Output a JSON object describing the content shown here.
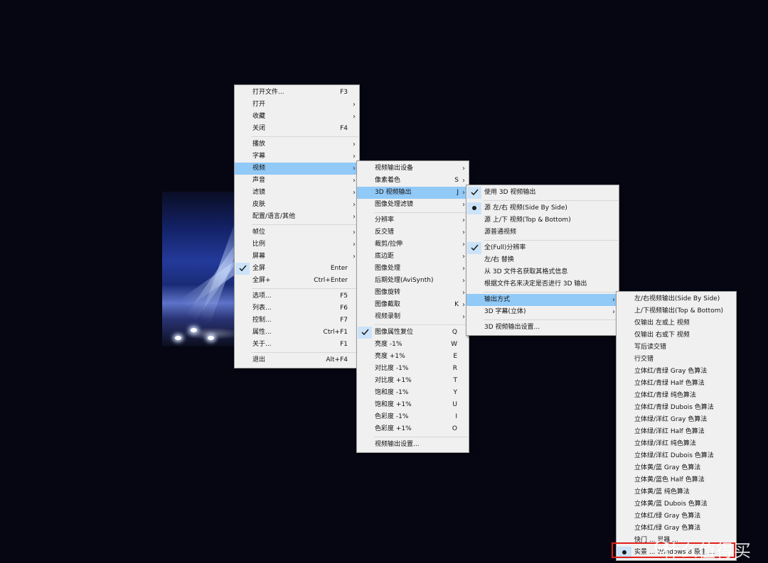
{
  "menu_main": [
    {
      "label": "打开文件...",
      "shortcut": "F3"
    },
    {
      "label": "打开",
      "arrow": true
    },
    {
      "label": "收藏",
      "arrow": true
    },
    {
      "label": "关闭",
      "shortcut": "F4"
    },
    {
      "sep": true
    },
    {
      "label": "播放",
      "arrow": true
    },
    {
      "label": "字幕",
      "arrow": true
    },
    {
      "label": "视频",
      "arrow": true,
      "highlight": true
    },
    {
      "label": "声音",
      "arrow": true
    },
    {
      "label": "滤镜",
      "arrow": true
    },
    {
      "label": "皮肤",
      "arrow": true
    },
    {
      "label": "配置/语言/其他",
      "arrow": true
    },
    {
      "sep": true
    },
    {
      "label": "帧位",
      "arrow": true
    },
    {
      "label": "比例",
      "arrow": true
    },
    {
      "label": "屏幕",
      "arrow": true
    },
    {
      "label": "全屏",
      "shortcut": "Enter",
      "check": true
    },
    {
      "label": "全屏+",
      "shortcut": "Ctrl+Enter"
    },
    {
      "sep": true
    },
    {
      "label": "选项...",
      "shortcut": "F5"
    },
    {
      "label": "列表...",
      "shortcut": "F6"
    },
    {
      "label": "控制...",
      "shortcut": "F7"
    },
    {
      "label": "属性...",
      "shortcut": "Ctrl+F1"
    },
    {
      "label": "关于...",
      "shortcut": "F1"
    },
    {
      "sep": true
    },
    {
      "label": "退出",
      "shortcut": "Alt+F4"
    }
  ],
  "menu_video": [
    {
      "label": "视频输出设备",
      "arrow": true
    },
    {
      "label": "像素着色",
      "shortcut": "S",
      "arrow": true
    },
    {
      "label": "3D 视频输出",
      "shortcut": "J",
      "arrow": true,
      "highlight": true
    },
    {
      "label": "图像处理滤镜",
      "arrow": true
    },
    {
      "sep": true
    },
    {
      "label": "分辨率",
      "arrow": true
    },
    {
      "label": "反交错",
      "arrow": true
    },
    {
      "label": "裁剪/拉伸",
      "arrow": true
    },
    {
      "label": "底边距",
      "arrow": true
    },
    {
      "label": "图像处理",
      "arrow": true
    },
    {
      "label": "后期处理(AviSynth)",
      "arrow": true
    },
    {
      "label": "图像旋转",
      "arrow": true
    },
    {
      "label": "图像截取",
      "shortcut": "K",
      "arrow": true
    },
    {
      "label": "视频录制",
      "arrow": true
    },
    {
      "sep": true
    },
    {
      "label": "图像属性复位",
      "shortcut": "Q",
      "check": true
    },
    {
      "label": "亮度 -1%",
      "shortcut": "W"
    },
    {
      "label": "亮度 +1%",
      "shortcut": "E"
    },
    {
      "label": "对比度 -1%",
      "shortcut": "R"
    },
    {
      "label": "对比度 +1%",
      "shortcut": "T"
    },
    {
      "label": "饱和度 -1%",
      "shortcut": "Y"
    },
    {
      "label": "饱和度 +1%",
      "shortcut": "U"
    },
    {
      "label": "色彩度 -1%",
      "shortcut": "I"
    },
    {
      "label": "色彩度 +1%",
      "shortcut": "O"
    },
    {
      "sep": true
    },
    {
      "label": "视频输出设置..."
    }
  ],
  "menu_3d": [
    {
      "label": "使用 3D 视频输出",
      "check": true
    },
    {
      "sep": true
    },
    {
      "label": "源 左/右 视频(Side By Side)",
      "dot": true
    },
    {
      "label": "源 上/下 视频(Top & Bottom)"
    },
    {
      "label": "源普通视频"
    },
    {
      "sep": true
    },
    {
      "label": "全(Full)分辨率",
      "check": true
    },
    {
      "label": "左/右 替换"
    },
    {
      "label": "从 3D 文件名获取其格式信息"
    },
    {
      "label": "根据文件名来决定是否进行 3D 输出"
    },
    {
      "sep": true
    },
    {
      "label": "输出方式",
      "arrow": true,
      "highlight": true
    },
    {
      "label": "3D 字幕(立体)",
      "arrow": true
    },
    {
      "sep": true
    },
    {
      "label": "3D 视频输出设置..."
    }
  ],
  "menu_output": [
    {
      "label": "左/右视频输出(Side By Side)"
    },
    {
      "label": "上/下视频输出(Top & Bottom)"
    },
    {
      "label": "仅输出 左或上 视频"
    },
    {
      "label": "仅输出 右或下 视频"
    },
    {
      "label": "写后读交错"
    },
    {
      "label": "行交错"
    },
    {
      "label": "立体红/青绿 Gray 色算法"
    },
    {
      "label": "立体红/青绿 Half 色算法"
    },
    {
      "label": "立体红/青绿 纯色算法"
    },
    {
      "label": "立体红/青绿 Dubois 色算法"
    },
    {
      "label": "立体绿/洋红 Gray 色算法"
    },
    {
      "label": "立体绿/洋红 Half 色算法"
    },
    {
      "label": "立体绿/洋红 纯色算法"
    },
    {
      "label": "立体绿/洋红 Dubois 色算法"
    },
    {
      "label": "立体黄/蓝 Gray 色算法"
    },
    {
      "label": "立体黄/蓝色 Half 色算法"
    },
    {
      "label": "立体黄/蓝 纯色算法"
    },
    {
      "label": "立体黄/蓝 Dubois 色算法"
    },
    {
      "label": "立体红/绿 Gray 色算法"
    },
    {
      "label": "立体红/绿 Gray 色算法"
    },
    {
      "label": "快门 ... 显器 ..."
    },
    {
      "label": "实景 ... Windows 8 原生 ...",
      "dot": true
    }
  ],
  "watermark": "什么值得买",
  "colors": {
    "highlight": "#91c9f7",
    "menu_bg": "#f0f0f0",
    "background": "#050612",
    "red_box": "#e0201a"
  }
}
